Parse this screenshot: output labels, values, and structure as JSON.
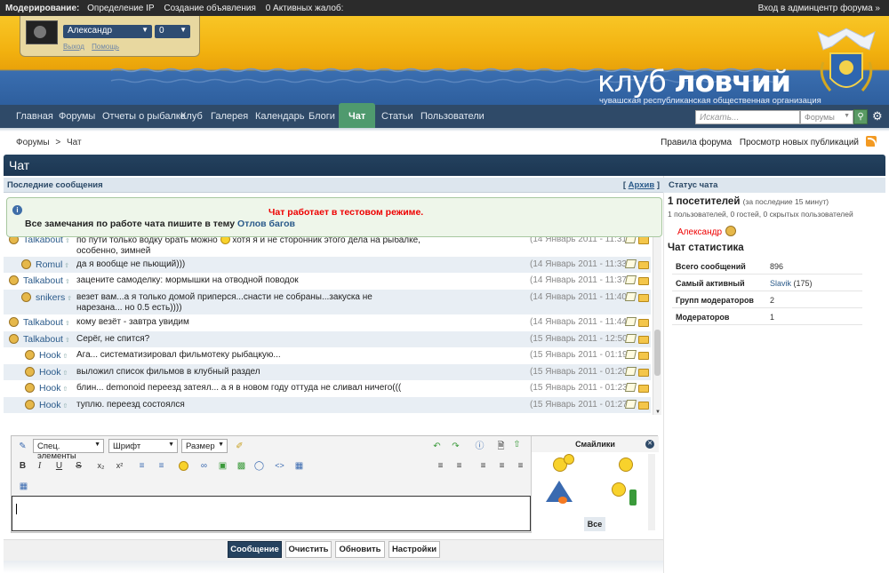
{
  "modbar": {
    "label": "Модерирование:",
    "items": [
      "Определение IP",
      "Создание объявления",
      "0 Активных жалоб:"
    ],
    "admin_link": "Вход в админцентр форума »"
  },
  "userbox": {
    "username": "Александр",
    "count": "0",
    "logout": "Выход",
    "help": "Помощь"
  },
  "logo": {
    "title_light": "клуб ",
    "title_bold": "ловчий",
    "subtitle": "чувашская республиканская общественная организация"
  },
  "nav": {
    "items": [
      "Главная",
      "Форумы",
      "Отчеты о рыбалке",
      "Клуб",
      "Галерея",
      "Календарь",
      "Блоги",
      "Чат",
      "Статьи",
      "Пользователи"
    ],
    "active": "Чат",
    "search_placeholder": "Искать...",
    "search_scope": "Форумы"
  },
  "breadcrumb": [
    "Форумы",
    ">",
    "Чат"
  ],
  "toplinks": [
    "Правила форума",
    "Просмотр новых публикаций"
  ],
  "page_title": "Чат",
  "left": {
    "heading": "Последние сообщения",
    "archive_open": "[",
    "archive": "Архив",
    "archive_close": "]"
  },
  "notice": {
    "red": "Чат работает в тестовом режиме.",
    "text": "Все замечания по работе чата пишите в тему",
    "link": "Отлов багов"
  },
  "messages": [
    {
      "user": "Talkabout",
      "text_a": "по пути только водку брать можно",
      "text_b": "хотя я и не сторонник этого дела на рыбалке, особенно, зимней",
      "time": "(14 Январь 2011 - 11:31 )"
    },
    {
      "user": "Romul",
      "text": "да я вообще не пьющий)))",
      "time": "(14 Январь 2011 - 11:33 )"
    },
    {
      "user": "Talkabout",
      "text": "зацените самоделку: мормышки на отводной поводок",
      "time": "(14 Январь 2011 - 11:37 )"
    },
    {
      "user": "snikers",
      "text": "везет вам...а я только домой приперся...снасти не собраны...закуска не нарезана... но 0.5 есть))))",
      "time": "(14 Январь 2011 - 11:40 )"
    },
    {
      "user": "Talkabout",
      "text": "кому везёт - завтра увидим",
      "time": "(14 Январь 2011 - 11:44 )"
    },
    {
      "user": "Talkabout",
      "text": "Серёг, не спится?",
      "time": "(15 Январь 2011 - 12:50 )"
    },
    {
      "user": "Hook",
      "text": "Ага... систематизировал фильмотеку рыбацкую...",
      "time": "(15 Январь 2011 - 01:19 )"
    },
    {
      "user": "Hook",
      "text": "выложил список фильмов в клубный раздел",
      "time": "(15 Январь 2011 - 01:20 )"
    },
    {
      "user": "Hook",
      "text": "блин... demonoid переезд затеял... а я в новом году оттуда не сливал ничего(((",
      "time": "(15 Январь 2011 - 01:23 )"
    },
    {
      "user": "Hook",
      "text": "туплю. переезд состоялся",
      "time": "(15 Январь 2011 - 01:27 )"
    }
  ],
  "editor": {
    "special": "Спец. элементы",
    "font": "Шрифт",
    "size": "Размер",
    "smilies_title": "Смайлики",
    "smilies_all": "Все"
  },
  "buttons": [
    "Сообщение",
    "Очистить",
    "Обновить",
    "Настройки"
  ],
  "right": {
    "heading": "Статус чата",
    "visitors": "1 посетителей",
    "visitors_note": "(за последние 15 минут)",
    "visitors_detail": "1 пользователей, 0 гостей, 0 скрытых пользователей",
    "online_user": "Александр",
    "stats_heading": "Чат статистика",
    "stats": [
      {
        "label": "Всего сообщений",
        "value": "896"
      },
      {
        "label": "Самый активный",
        "value": "Slavik",
        "extra": "(175)"
      },
      {
        "label": "Групп модераторов",
        "value": "2"
      },
      {
        "label": "Модераторов",
        "value": "1"
      }
    ]
  },
  "colors": {
    "nav_bg": "#2f4a68",
    "active_tab": "#4f9a6e",
    "header_yellow": "#f2b10f",
    "header_blue": "#2e5f9e",
    "notice_red": "#ee0000"
  }
}
